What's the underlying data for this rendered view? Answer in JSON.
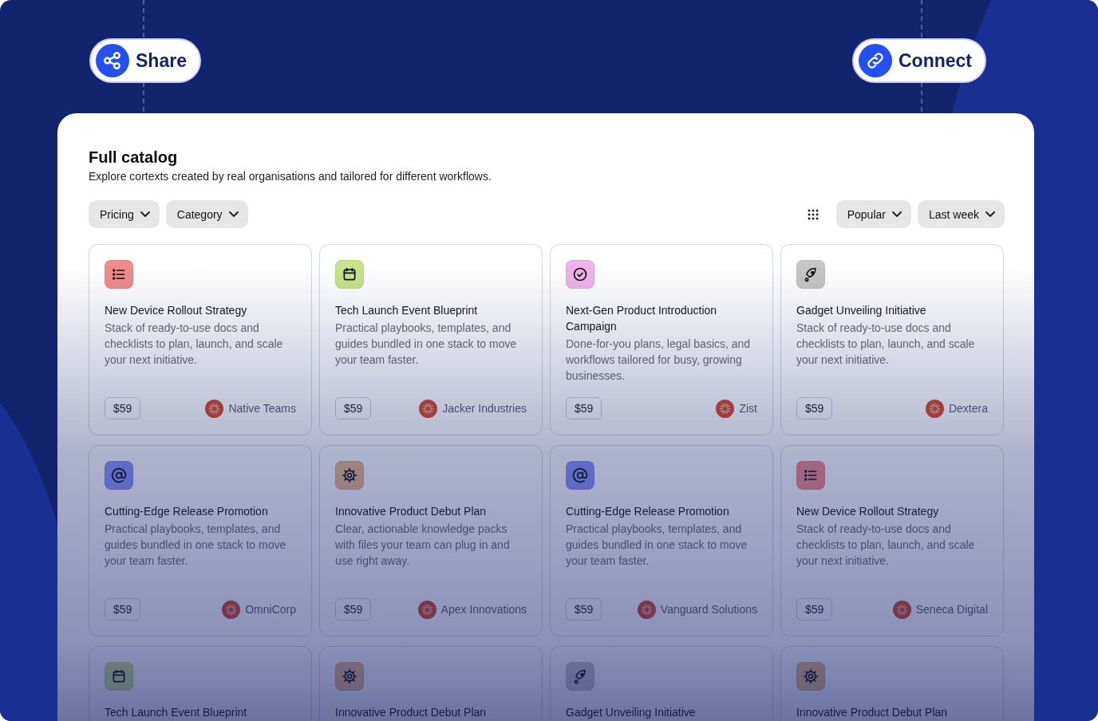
{
  "header_buttons": [
    {
      "kind": "share",
      "label": "Share"
    },
    {
      "kind": "connect",
      "label": "Connect"
    }
  ],
  "catalog": {
    "title": "Full catalog",
    "subtitle": "Explore cortexts created by real organisations and tailored for different workflows.",
    "filters": [
      {
        "label": "Pricing"
      },
      {
        "label": "Category"
      }
    ],
    "sorts": [
      {
        "label": "Popular"
      },
      {
        "label": "Last week"
      }
    ],
    "cards": [
      {
        "kind": "list",
        "title": "New Device Rollout Strategy",
        "description": "Stack of ready-to-use docs and checklists to plan, launch, and scale your next initiative.",
        "price": "$59",
        "vendor": "Native Teams"
      },
      {
        "kind": "calendar",
        "title": "Tech Launch Event Blueprint",
        "description": "Practical playbooks, templates, and guides bundled in one stack to move your team faster.",
        "price": "$59",
        "vendor": "Jacker Industries"
      },
      {
        "kind": "check",
        "title": "Next-Gen Product Introduction Campaign",
        "description": "Done-for-you plans, legal basics, and workflows tailored for busy, growing businesses.",
        "price": "$59",
        "vendor": "Zist"
      },
      {
        "kind": "rocket",
        "title": "Gadget Unveiling Initiative",
        "description": "Stack of ready-to-use docs and checklists to plan, launch, and scale your next initiative.",
        "price": "$59",
        "vendor": "Dextera"
      },
      {
        "kind": "at",
        "title": "Cutting-Edge Release Promotion",
        "description": "Practical playbooks, templates, and guides bundled in one stack to move your team faster.",
        "price": "$59",
        "vendor": "OmniCorp"
      },
      {
        "kind": "gear",
        "title": "Innovative Product Debut Plan",
        "description": "Clear, actionable knowledge packs with files your team can plug in and use right away.",
        "price": "$59",
        "vendor": "Apex Innovations"
      },
      {
        "kind": "at",
        "title": "Cutting-Edge Release Promotion",
        "description": "Practical playbooks, templates, and guides bundled in one stack to move your team faster.",
        "price": "$59",
        "vendor": "Vanguard Solutions"
      },
      {
        "kind": "list",
        "title": "New Device Rollout Strategy",
        "description": "Stack of ready-to-use docs and checklists to plan, launch, and scale your next initiative.",
        "price": "$59",
        "vendor": "Seneca Digital"
      },
      {
        "kind": "calendar",
        "title": "Tech Launch Event Blueprint"
      },
      {
        "kind": "gear",
        "title": "Innovative Product Debut Plan"
      },
      {
        "kind": "rocket",
        "title": "Gadget Unveiling Initiative"
      },
      {
        "kind": "gear",
        "title": "Innovative Product Debut Plan"
      }
    ]
  }
}
